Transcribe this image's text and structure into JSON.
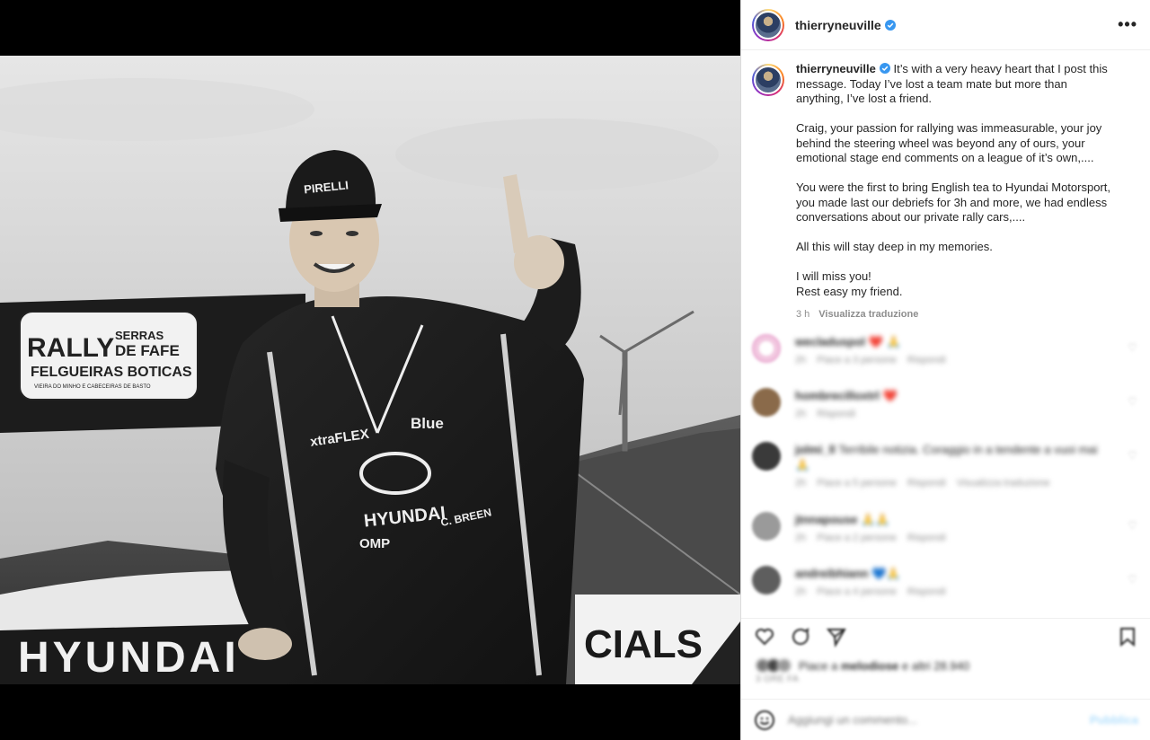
{
  "header": {
    "username": "thierryneuville",
    "more_label": "•••"
  },
  "caption": {
    "username": "thierryneuville",
    "paragraph1": "It’s with a very heavy heart that I post this message. Today I’ve lost a team mate but more than anything, I’ve lost a friend.",
    "paragraph2": "Craig, your passion for rallying was immeasurable, your joy behind the steering wheel was beyond any of ours, your emotional stage end comments on a league of it’s own,....",
    "paragraph3": "You were the first to bring English tea to Hyundai Motorsport, you made last our debriefs for 3h and more, we had endless conversations about our private rally cars,....",
    "paragraph4": "All this will stay deep in my memories.",
    "paragraph5a": "I will miss you!",
    "paragraph5b": "Rest easy my friend.",
    "time": "3 h",
    "translate_label": "Visualizza traduzione"
  },
  "comments": [
    {
      "username": "wecladuspol",
      "text": "❤️ 🙏",
      "meta_time": "2h",
      "meta_likes": "Piace a 3 persone",
      "reply_label": "Rispondi",
      "avatar_color": "#f2c8e0"
    },
    {
      "username": "hombrecilloxtrl",
      "text": "❤️",
      "meta_time": "2h",
      "meta_likes": "",
      "reply_label": "Rispondi",
      "avatar_color": "#8a6a4a"
    },
    {
      "username": "jolmi_ll",
      "text": "Terribile notizia. Coraggio in a tendente a vuoi mai 🙏",
      "meta_time": "2h",
      "meta_likes": "Piace a 5 persone",
      "reply_label": "Rispondi",
      "extra": "Visualizza traduzione",
      "avatar_color": "#3a3a3a"
    },
    {
      "username": "jtnnapouse",
      "text": "🙏🙏",
      "meta_time": "2h",
      "meta_likes": "Piace a 2 persone",
      "reply_label": "Rispondi",
      "avatar_color": "#9a9a9a"
    },
    {
      "username": "andreibhiann",
      "text": "💙🙏",
      "meta_time": "2h",
      "meta_likes": "Piace a 4 persone",
      "reply_label": "Rispondi",
      "avatar_color": "#5e5e5e"
    }
  ],
  "likes": {
    "text_prefix": "Piace a ",
    "first_liker": "melodiose",
    "text_suffix": " e altri 28.940"
  },
  "time_ago": "3 ORE FA",
  "add_comment": {
    "placeholder": "Aggiungi un commento...",
    "publish_label": "Pubblica"
  },
  "photo": {
    "banner_line1": "RALLY",
    "banner_line2": "SERRAS",
    "banner_line3": "DE FAFE",
    "banner_line4": "FELGUEIRAS BOTICAS",
    "banner_line5": "VIEIRA DO MINHO E CABECEIRAS DE BASTO",
    "cap_brand": "PIRELLI",
    "suit_brand1": "HYUNDAI",
    "suit_brand2": "xtraFLEX",
    "suit_brand3": "Blue",
    "suit_brand4": "OMP",
    "suit_name": "C. BREEN",
    "car_brand": "HYUNDAI",
    "right_text": "CIALS"
  },
  "colors": {
    "accent": "#0095f6",
    "verified": "#3897f0",
    "text": "#262626",
    "secondary": "#8e8e8e"
  }
}
